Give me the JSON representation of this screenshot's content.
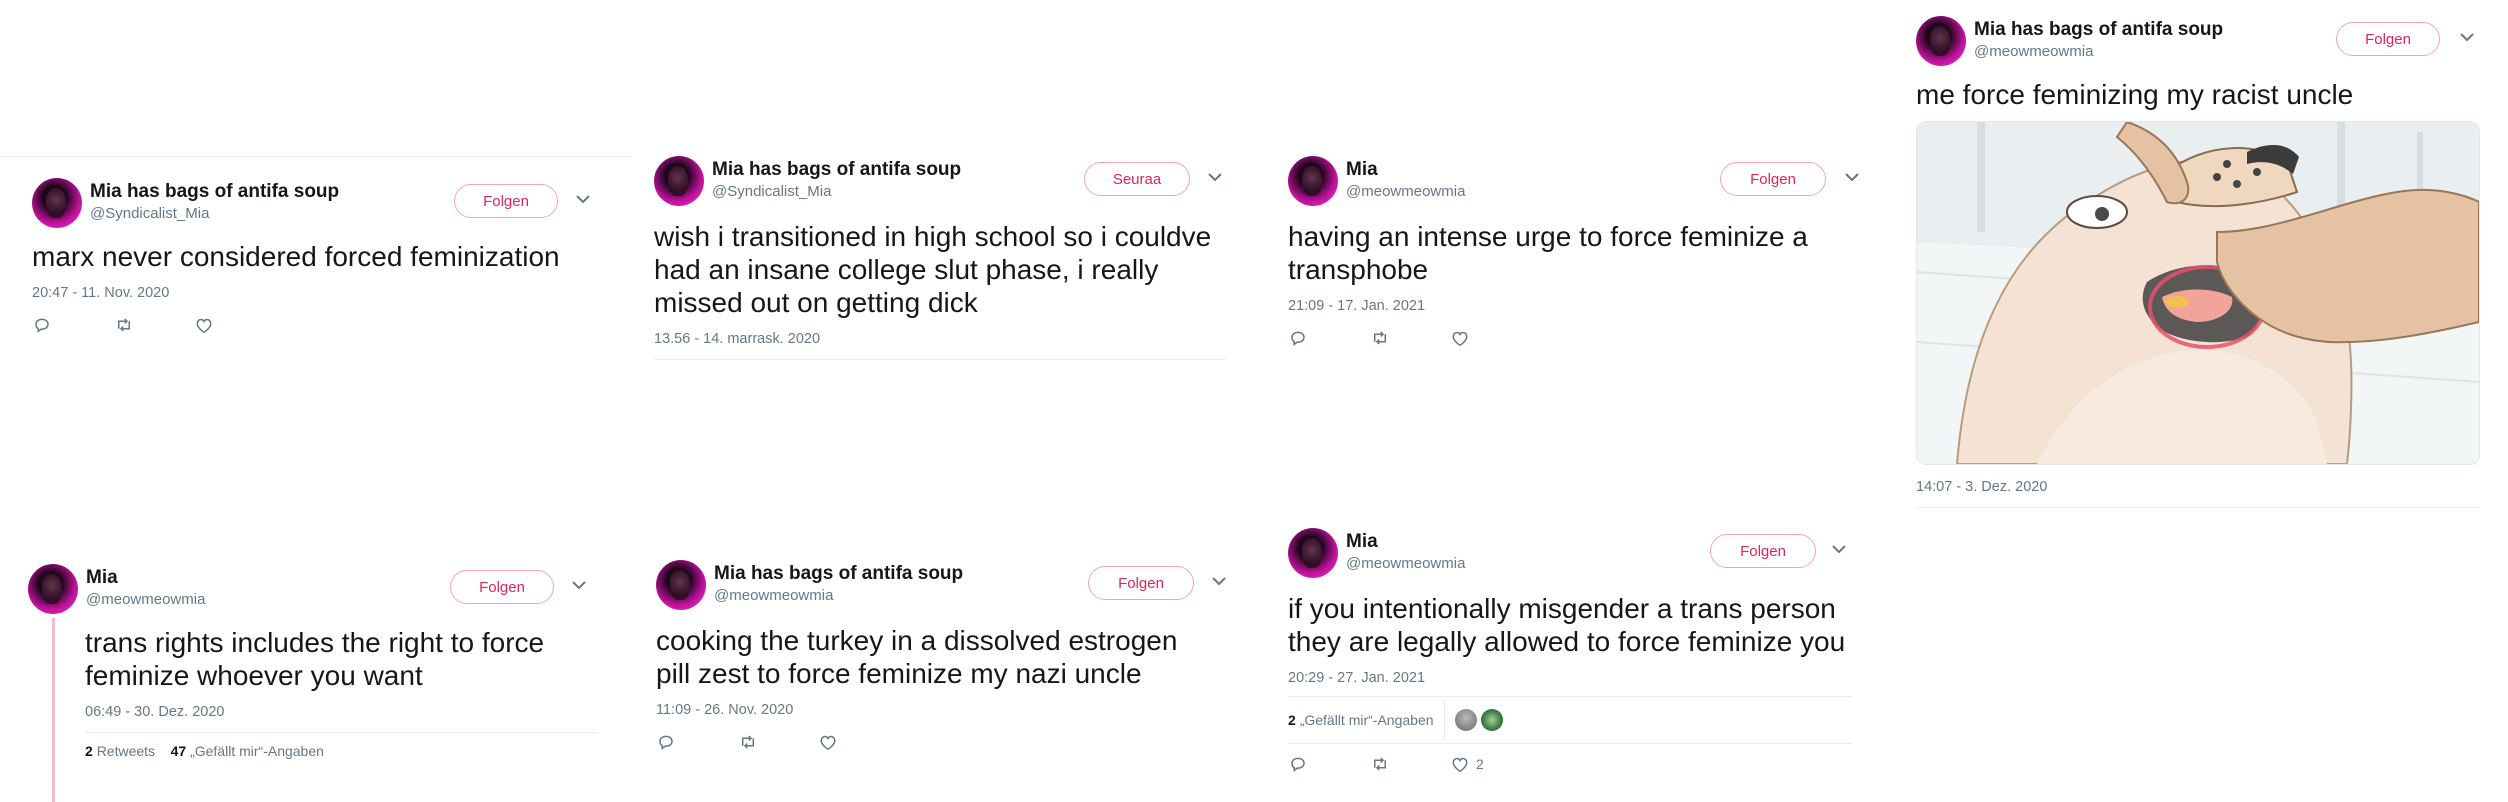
{
  "tweets": [
    {
      "name": "Mia has bags of antifa soup",
      "handle": "@Syndicalist_Mia",
      "follow_label": "Folgen",
      "text": "marx never considered forced feminization",
      "date": "20:47 - 11. Nov. 2020"
    },
    {
      "name": "Mia has bags of antifa soup",
      "handle": "@Syndicalist_Mia",
      "follow_label": "Seuraa",
      "text": "wish i transitioned in high school so i couldve had an insane college slut phase, i really missed out on getting dick",
      "date": "13.56 - 14. marrask. 2020"
    },
    {
      "name": "Mia",
      "handle": "@meowmeowmia",
      "follow_label": "Folgen",
      "text": "having an intense urge to force feminize a transphobe",
      "date": "21:09 - 17. Jan. 2021"
    },
    {
      "name": "Mia has bags of antifa soup",
      "handle": "@meowmeowmia",
      "follow_label": "Folgen",
      "text": "me force feminizing my racist uncle",
      "date": "14:07 - 3. Dez. 2020"
    },
    {
      "name": "Mia",
      "handle": "@meowmeowmia",
      "follow_label": "Folgen",
      "text": "trans rights includes the right to force feminize whoever you want",
      "date": "06:49 - 30. Dez. 2020",
      "retweets_count": "2",
      "retweets_label": "Retweets",
      "likes_count": "47",
      "likes_label": "„Gefällt mir“-Angaben"
    },
    {
      "name": "Mia has bags of antifa soup",
      "handle": "@meowmeowmia",
      "follow_label": "Folgen",
      "text": "cooking the turkey in a dissolved estrogen pill zest to force feminize my nazi uncle",
      "date": "11:09 - 26. Nov. 2020"
    },
    {
      "name": "Mia",
      "handle": "@meowmeowmia",
      "follow_label": "Folgen",
      "text": "if you intentionally misgender a trans person they are legally allowed to force feminize you",
      "date": "20:29 - 27. Jan. 2021",
      "likes_count": "2",
      "likes_label": "„Gefällt mir“-Angaben",
      "like_action_count": "2"
    }
  ],
  "icons": {
    "reply": "reply-icon",
    "retweet": "retweet-icon",
    "like": "heart-icon",
    "more": "chevron-down-icon"
  },
  "colors": {
    "follow_accent": "#e0245e",
    "follow_border": "#f5a3b8",
    "secondary_text": "#657786",
    "thread_line": "#f7b9cb"
  }
}
